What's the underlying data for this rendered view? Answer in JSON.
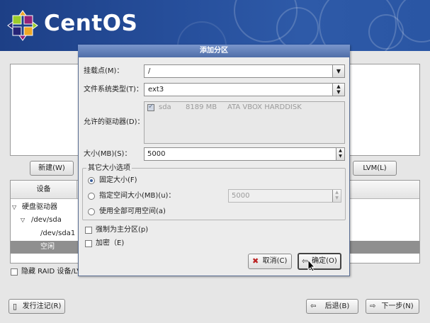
{
  "brand": {
    "name": "CentOS"
  },
  "installer": {
    "new_button": "新建(W)",
    "lvm_button": "LVM(L)",
    "column_device": "设备",
    "tree": {
      "root": "硬盘驱动器",
      "disk": "/dev/sda",
      "partition": "/dev/sda1",
      "free": "空闲"
    },
    "hide_raid_label": "隐藏 RAID 设备/LV",
    "release_notes_button": "发行注记(R)",
    "back_button": "后退(B)",
    "next_button": "下一步(N)"
  },
  "dialog": {
    "title": "添加分区",
    "mount_point_label": "挂载点(M)：",
    "mount_point_value": "/",
    "fs_type_label": "文件系统类型(T)：",
    "fs_type_value": "ext3",
    "drives_label": "允许的驱动器(D)：",
    "drive": {
      "name": "sda",
      "size": "8189 MB",
      "model": "ATA VBOX HARDDISK"
    },
    "size_label": "大小(MB)(S)：",
    "size_value": "5000",
    "other_size_group": "其它大小选项",
    "fixed_size": "固定大小(F)",
    "fill_up_to": "指定空间大小(MB)(u)：",
    "fill_up_to_value": "5000",
    "fill_all": "使用全部可用空间(a)",
    "force_primary": "强制为主分区(p)",
    "encrypt": "加密（E)",
    "cancel_button": "取消(C)",
    "ok_button": "确定(O)"
  },
  "colors": {
    "banner": "#27509d",
    "dialog_title": "#5d7bb5",
    "selection_row": "#8f8f8f"
  }
}
